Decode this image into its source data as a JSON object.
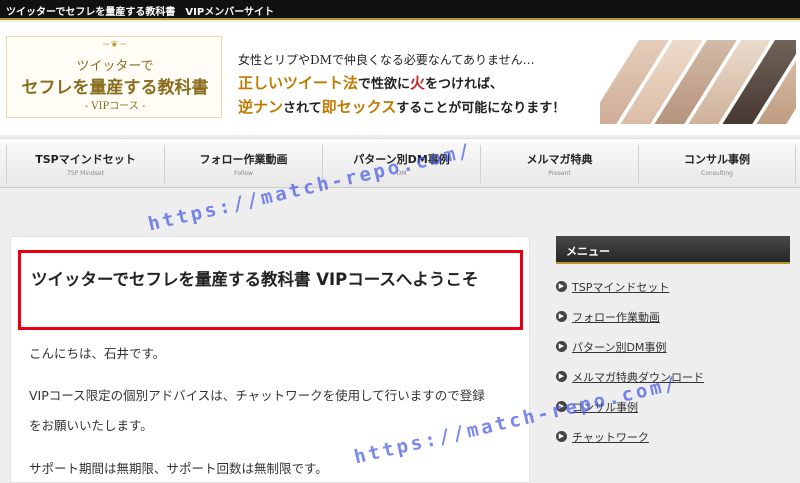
{
  "topbar": {
    "title": "ツイッターでセフレを量産する教科書　VIPメンバーサイト"
  },
  "logo": {
    "line1": "ツイッターで",
    "line2": "セフレを量産する教科書",
    "line3": "- VIPコース -",
    "ornament": "~❦~"
  },
  "catch": {
    "line1": "女性とリプやDMで仲良くなる必要なんてありません…",
    "line2_a": "正しいツイート法",
    "line2_b": "で性欲に",
    "line2_c": "火",
    "line2_d": "をつければ、",
    "line3_a": "逆ナン",
    "line3_b": "されて",
    "line3_c": "即セックス",
    "line3_d": "することが可能になります！"
  },
  "nav": [
    {
      "label": "TSPマインドセット",
      "sub": "TSP Mindset"
    },
    {
      "label": "フォロー作業動画",
      "sub": "Follow"
    },
    {
      "label": "パターン別DM事例",
      "sub": "DM"
    },
    {
      "label": "メルマガ特典",
      "sub": "Present"
    },
    {
      "label": "コンサル事例",
      "sub": "Consulting"
    }
  ],
  "post": {
    "title": "ツイッターでセフレを量産する教科書 VIPコースへようこそ",
    "p1": "こんにちは、石井です。",
    "p2": "VIPコース限定の個別アドバイスは、チャットワークを使用して行いますので登録",
    "p3": "をお願いいたします。",
    "p4": "サポート期間は無期限、サポート回数は無制限です。"
  },
  "sidebar": {
    "heading": "メニュー",
    "items": [
      {
        "label": "TSPマインドセット"
      },
      {
        "label": "フォロー作業動画"
      },
      {
        "label": "パターン別DM事例"
      },
      {
        "label": "メルマガ特典ダウンロード"
      },
      {
        "label": "コンサル事例"
      },
      {
        "label": "チャットワーク"
      }
    ]
  },
  "watermark": {
    "text": "https://match-repo.com/"
  },
  "colors": {
    "accent_gold": "#b8962e",
    "highlight_red": "#e60012",
    "topbar": "#111111",
    "watermark": "#4a5ae6"
  }
}
